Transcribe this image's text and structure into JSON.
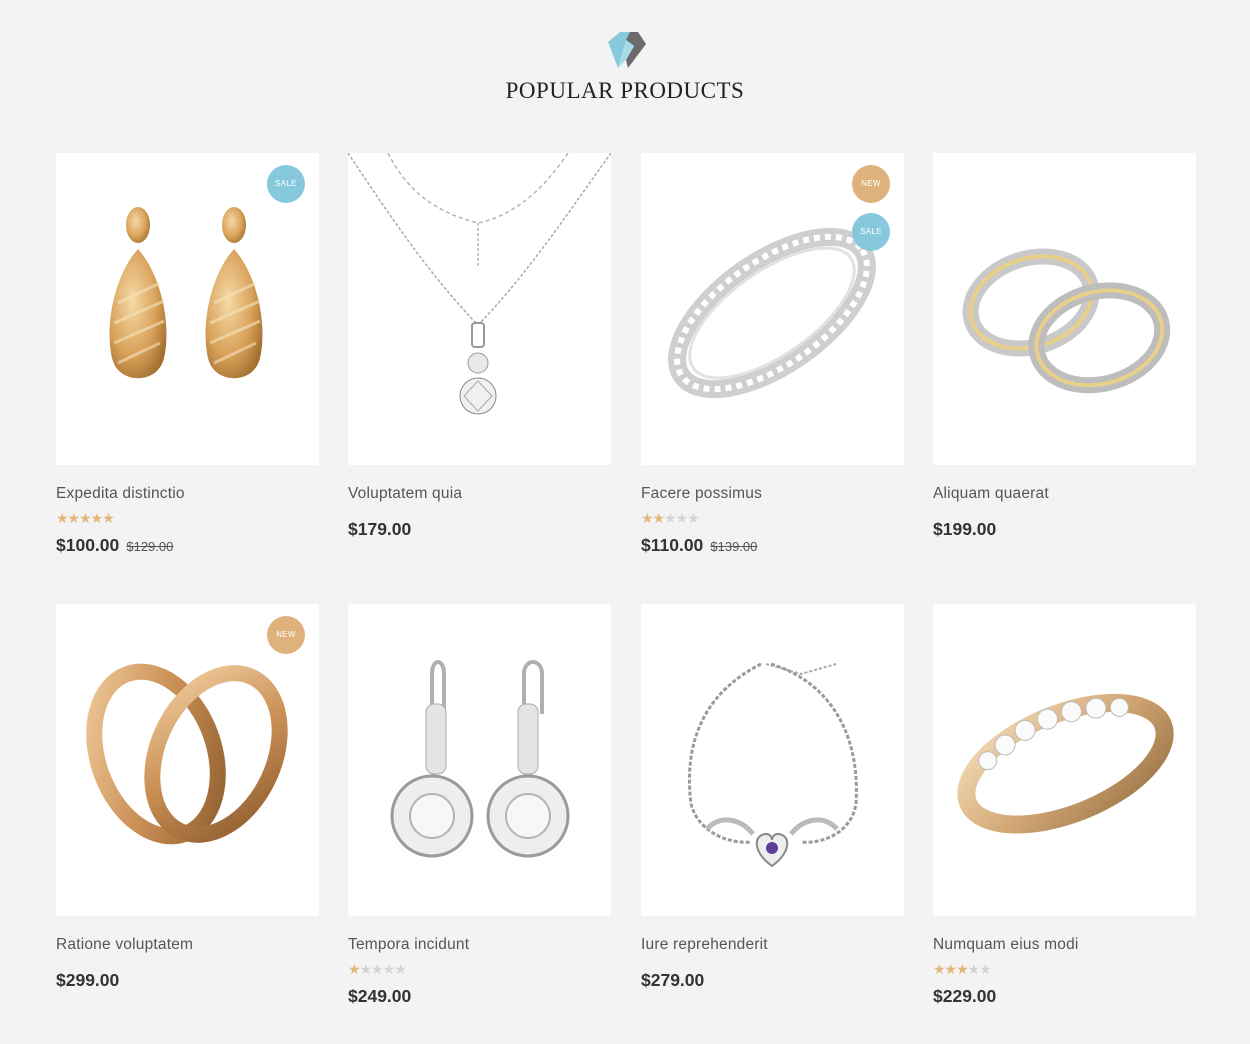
{
  "section": {
    "title": "POPULAR PRODUCTS",
    "logo_icon": "diamond-icon",
    "accent_blue": "#86c9dc",
    "accent_gold": "#deb27a"
  },
  "products": [
    {
      "name": "Expedita distinctio",
      "price": "$100.00",
      "old_price": "$129.00",
      "rating": 5,
      "badges": [
        "SALE"
      ],
      "image": "gold-drop-earrings"
    },
    {
      "name": "Voluptatem quia",
      "price": "$179.00",
      "old_price": "",
      "rating": null,
      "badges": [],
      "image": "silver-pendant-necklace"
    },
    {
      "name": "Facere possimus",
      "price": "$110.00",
      "old_price": "$139.00",
      "rating": 2,
      "badges": [
        "NEW",
        "SALE"
      ],
      "image": "diamond-band-ring"
    },
    {
      "name": "Aliquam quaerat",
      "price": "$199.00",
      "old_price": "",
      "rating": null,
      "badges": [],
      "image": "two-tone-wedding-rings"
    },
    {
      "name": "Ratione voluptatem",
      "price": "$299.00",
      "old_price": "",
      "rating": null,
      "badges": [
        "NEW"
      ],
      "image": "gold-interlocked-rings"
    },
    {
      "name": "Tempora incidunt",
      "price": "$249.00",
      "old_price": "",
      "rating": 1,
      "badges": [],
      "image": "silver-halo-earrings"
    },
    {
      "name": "Iure reprehenderit",
      "price": "$279.00",
      "old_price": "",
      "rating": null,
      "badges": [],
      "image": "heart-wings-bracelet"
    },
    {
      "name": "Numquam eius modi",
      "price": "$229.00",
      "old_price": "",
      "rating": 3,
      "badges": [],
      "image": "gold-eternity-ring"
    }
  ]
}
